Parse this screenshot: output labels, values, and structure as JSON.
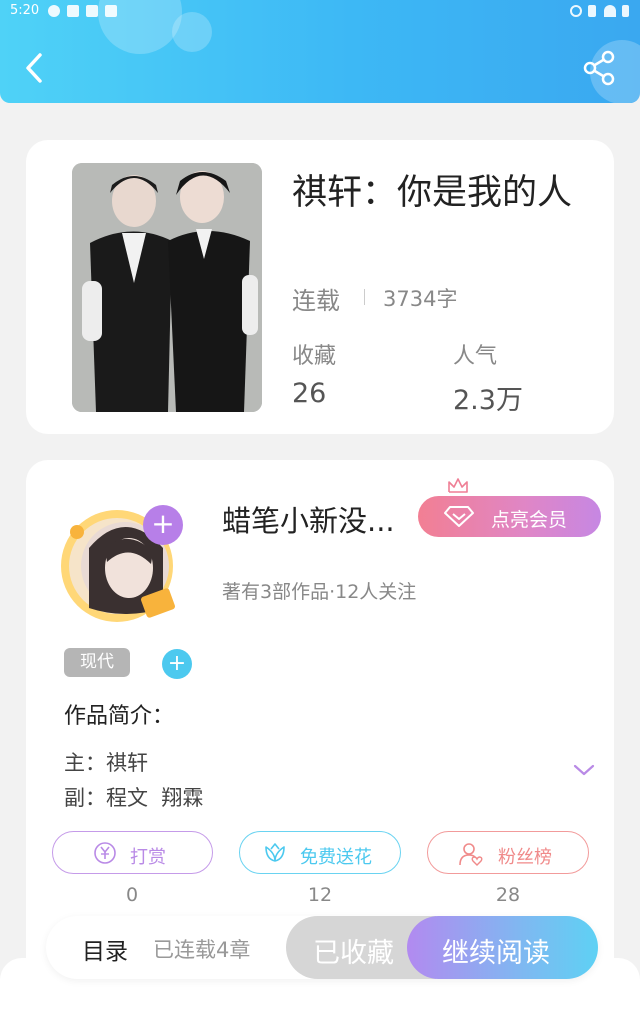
{
  "status_bar": {
    "time": "5:20"
  },
  "book": {
    "title": "祺轩：你是我的人",
    "status": "连载",
    "word_count": "3734字",
    "favorites_label": "收藏",
    "favorites_value": "26",
    "popularity_label": "人气",
    "popularity_value": "2.3万"
  },
  "author": {
    "name": "蜡笔小新没...",
    "vip_button": "点亮会员",
    "meta": "著有3部作品·12人关注"
  },
  "tags": [
    "现代"
  ],
  "intro": {
    "heading": "作品简介：",
    "lines": [
      "主：祺轩",
      "副：程文  翔霖"
    ]
  },
  "actions": [
    {
      "label": "打赏",
      "count": "0",
      "color": "#b98ae6"
    },
    {
      "label": "免费送花",
      "count": "12",
      "color": "#4cc9ef"
    },
    {
      "label": "粉丝榜",
      "count": "28",
      "color": "#f08a8a"
    }
  ],
  "bottom_bar": {
    "toc_label": "目录",
    "chapters": "已连载4章",
    "favorited_button": "已收藏",
    "continue_button": "继续阅读"
  }
}
